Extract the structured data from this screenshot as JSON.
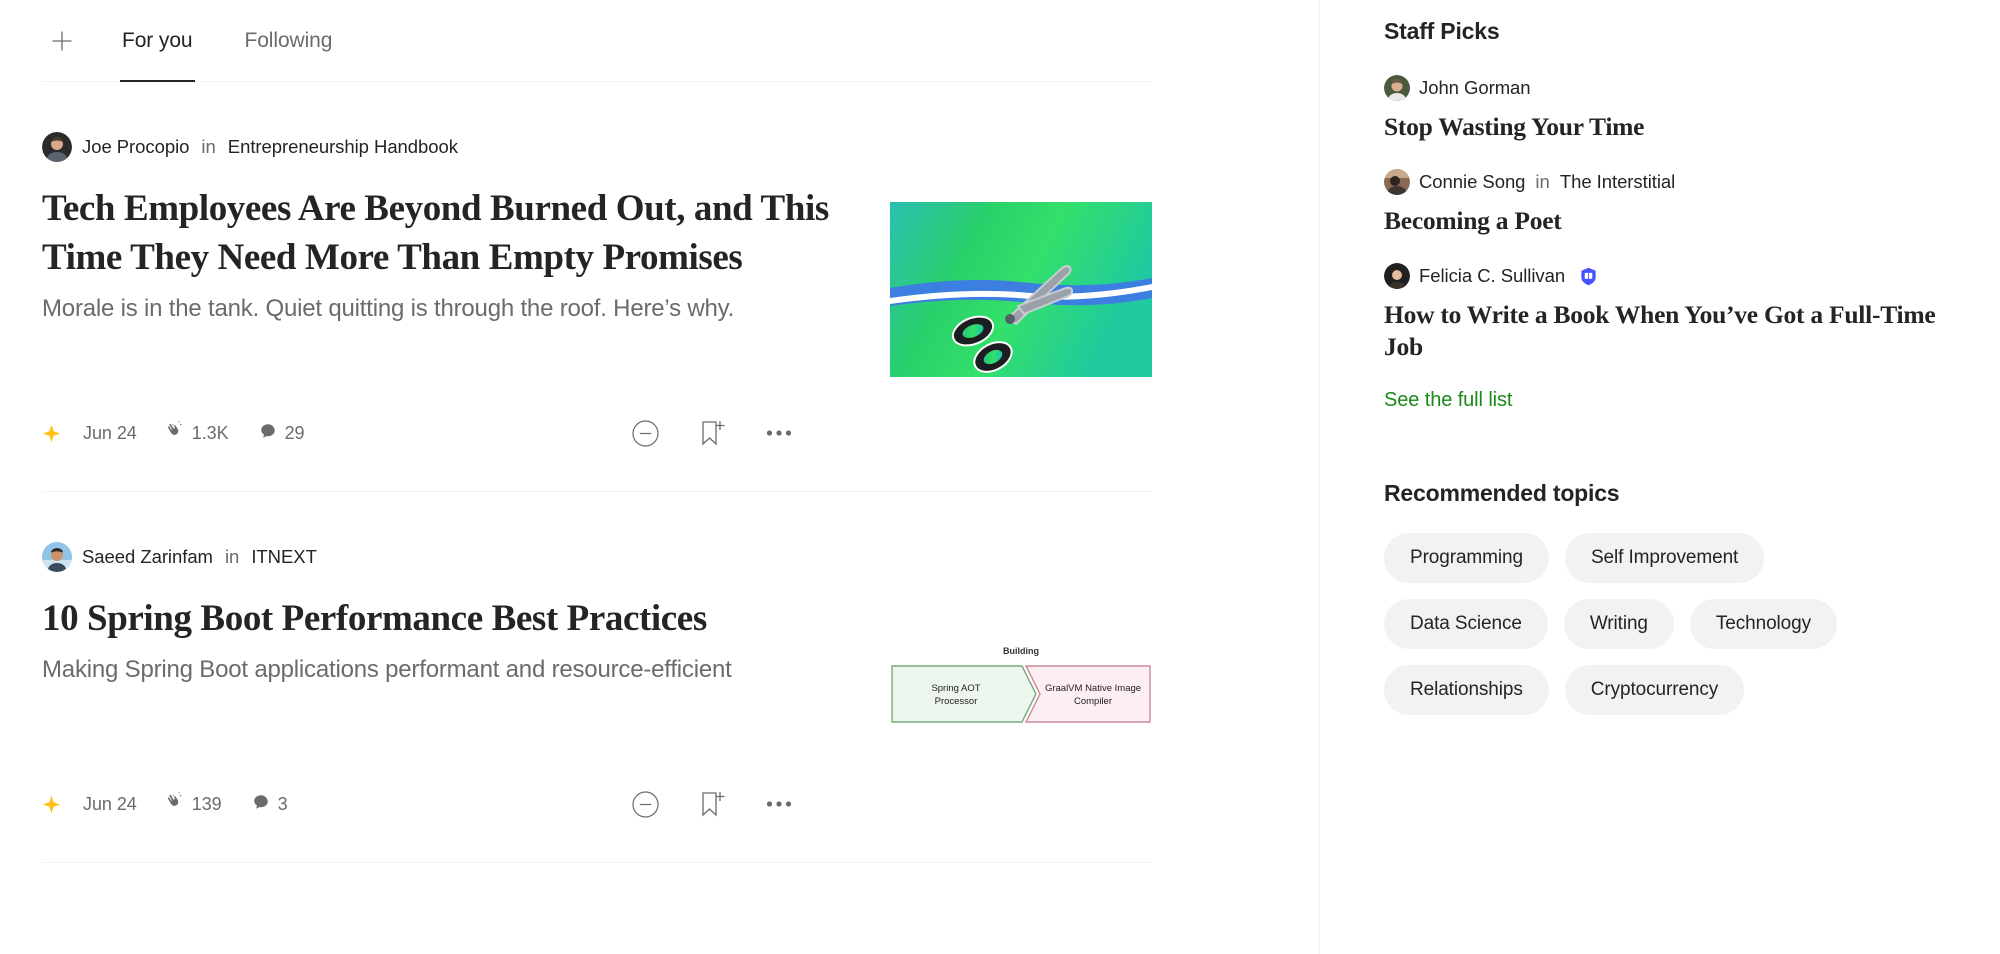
{
  "tabs": {
    "new_story_icon": "plus-icon",
    "items": [
      {
        "label": "For you",
        "active": true
      },
      {
        "label": "Following",
        "active": false
      }
    ]
  },
  "feed": {
    "stories": [
      {
        "author": "Joe Procopio",
        "in_word": "in",
        "publication": "Entrepreneurship Handbook",
        "title": "Tech Employees Are Beyond Burned Out, and This Time They Need More Than Empty Promises",
        "subtitle": "Morale is in the tank. Quiet quitting is through the roof. Here’s why.",
        "member_icon": "star-icon",
        "date": "Jun 24",
        "claps_icon": "clap-icon",
        "claps": "1.3K",
        "comments_icon": "comment-icon",
        "comments": "29",
        "actions": [
          "hide-circle-minus-icon",
          "bookmark-plus-icon",
          "ellipsis-icon"
        ],
        "thumbnail": "scissors-cutting-green-blue-gradient"
      },
      {
        "author": "Saeed Zarinfam",
        "in_word": "in",
        "publication": "ITNEXT",
        "title": "10 Spring Boot Performance Best Practices",
        "subtitle": "Making Spring Boot applications performant and resource-efficient",
        "member_icon": "star-icon",
        "date": "Jun 24",
        "claps_icon": "clap-icon",
        "claps": "139",
        "comments_icon": "comment-icon",
        "comments": "3",
        "actions": [
          "hide-circle-minus-icon",
          "bookmark-plus-icon",
          "ellipsis-icon"
        ],
        "thumbnail": {
          "caption": "Building",
          "left_box": "Spring AOT Processor",
          "right_box": "GraalVM Native Image Compiler"
        }
      }
    ]
  },
  "sidebar": {
    "staff_picks_heading": "Staff Picks",
    "picks": [
      {
        "author": "John Gorman",
        "in_word": "",
        "publication": "",
        "verified": false,
        "title": "Stop Wasting Your Time"
      },
      {
        "author": "Connie Song",
        "in_word": "in",
        "publication": "The Interstitial",
        "verified": false,
        "title": "Becoming a Poet"
      },
      {
        "author": "Felicia C. Sullivan",
        "in_word": "",
        "publication": "",
        "verified": true,
        "verified_icon": "book-badge-icon",
        "title": "How to Write a Book When You’ve Got a Full-Time Job"
      }
    ],
    "see_full_list": "See the full list",
    "topics_heading": "Recommended topics",
    "topics": [
      "Programming",
      "Self Improvement",
      "Data Science",
      "Writing",
      "Technology",
      "Relationships",
      "Cryptocurrency"
    ]
  },
  "colors": {
    "text_primary": "#242424",
    "text_secondary": "#6b6b6b",
    "link_green": "#1a8917",
    "star_yellow": "#ffc017",
    "pill_bg": "#f2f2f2",
    "badge_blue": "#4353ff"
  }
}
